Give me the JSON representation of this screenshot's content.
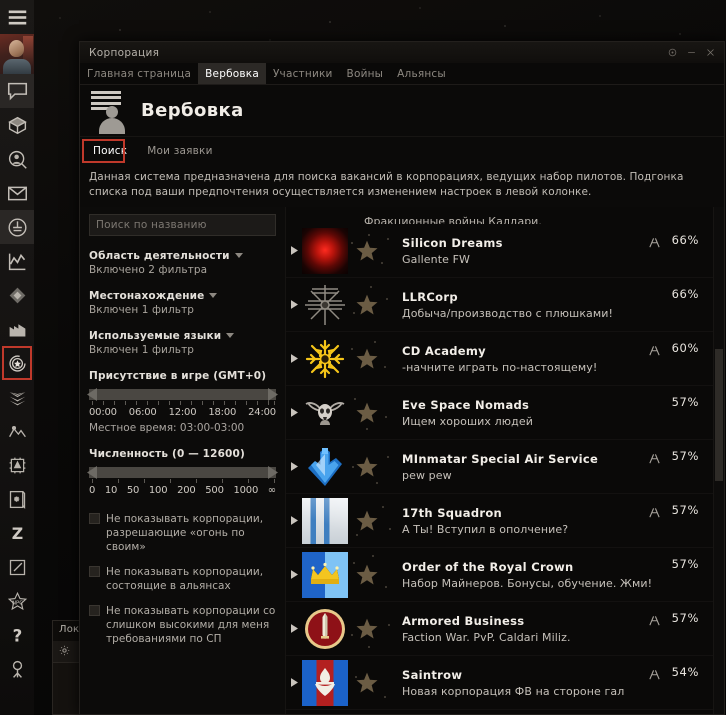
{
  "neocom": {
    "items": [
      {
        "name": "menu-icon",
        "label": "Меню"
      },
      {
        "name": "chat-icon",
        "label": "Чат"
      },
      {
        "name": "cargo-icon",
        "label": "Инвентарь"
      },
      {
        "name": "character-search-icon",
        "label": "Поиск персонажа"
      },
      {
        "name": "mail-icon",
        "label": "Почта"
      },
      {
        "name": "station-icon",
        "label": "Станция"
      },
      {
        "name": "market-chart-icon",
        "label": "Рынок"
      },
      {
        "name": "map-icon",
        "label": "Карта"
      },
      {
        "name": "industry-icon",
        "label": "Производство"
      },
      {
        "name": "corporation-icon",
        "label": "Корпорация"
      },
      {
        "name": "fleet-icon",
        "label": "Флот"
      },
      {
        "name": "agency-icon",
        "label": "Агентство"
      },
      {
        "name": "fitting-icon",
        "label": "Сборка"
      },
      {
        "name": "journal-icon",
        "label": "Журнал"
      },
      {
        "name": "zkill-icon",
        "label": "Z"
      },
      {
        "name": "notepad-icon",
        "label": "Заметки"
      },
      {
        "name": "npc-standings-icon",
        "label": "Репутация"
      },
      {
        "name": "help-icon",
        "label": "Помощь"
      },
      {
        "name": "clone-icon",
        "label": "Клон"
      }
    ],
    "selected": "corporation-icon"
  },
  "background_panel": {
    "title": "Лок",
    "gear_icon": "gear-icon"
  },
  "window": {
    "title": "Корпорация",
    "controls": {
      "settings": "settings-icon",
      "minimize": "minimize-icon",
      "close": "close-icon"
    },
    "tabs": [
      {
        "label": "Главная страница",
        "active": false
      },
      {
        "label": "Вербовка",
        "active": true
      },
      {
        "label": "Участники",
        "active": false
      },
      {
        "label": "Войны",
        "active": false
      },
      {
        "label": "Альянсы",
        "active": false
      }
    ],
    "header": {
      "icon": "recruitment-icon",
      "title": "Вербовка"
    },
    "subtabs": [
      {
        "label": "Поиск",
        "selected": true
      },
      {
        "label": "Мои заявки",
        "selected": false
      }
    ],
    "description": "Данная система предназначена для поиска вакансий в корпорациях, ведущих набор пилотов. Подгонка списка под ваши предпочтения осуществляется изменением настроек в левой колонке."
  },
  "filters": {
    "search": {
      "placeholder": "Поиск по названию",
      "value": ""
    },
    "groups": [
      {
        "title": "Область деятельности",
        "chevron": "chevron-down-icon",
        "status": "Включено 2 фильтра"
      },
      {
        "title": "Местонахождение",
        "chevron": "chevron-down-icon",
        "status": "Включен 1 фильтр"
      },
      {
        "title": "Используемые языки",
        "chevron": "chevron-down-icon",
        "status": "Включен 1 фильтр"
      }
    ],
    "presence_slider": {
      "title": "Присутствие в игре (GMT+0)",
      "ticks": [
        "00:00",
        "06:00",
        "12:00",
        "18:00",
        "24:00"
      ],
      "local_time_label": "Местное время: 03:00-03:00",
      "range": [
        0,
        24
      ]
    },
    "size_slider": {
      "title": "Численность (0 — 12600)",
      "ticks": [
        "0",
        "10",
        "50",
        "100",
        "200",
        "500",
        "1000",
        "∞"
      ],
      "range": [
        0,
        12600
      ]
    },
    "checkboxes": [
      {
        "label": "Не показывать корпорации, разрешающие «огонь по своим»",
        "checked": false
      },
      {
        "label": "Не показывать корпорации, состоящие в альянсах",
        "checked": false
      },
      {
        "label": "Не показывать корпорации со слишком высокими для меня требованиями по СП",
        "checked": false
      }
    ]
  },
  "corp_list": {
    "clipped_top_row": "Фракционные войны Калдари.",
    "rows": [
      {
        "name": "Silicon Dreams",
        "desc": "Gallente FW",
        "pct": "66%",
        "alliance": true,
        "logo": "red-glow"
      },
      {
        "name": "LLRCorp",
        "desc": "Добыча/производство с плюшками!",
        "pct": "66%",
        "alliance": false,
        "logo": "compass-star"
      },
      {
        "name": "CD Academy",
        "desc": "-начните играть по-настоящему!",
        "pct": "60%",
        "alliance": true,
        "logo": "gold-snowflake"
      },
      {
        "name": "Eve Space Nomads",
        "desc": "Ищем хороших людей",
        "pct": "57%",
        "alliance": false,
        "logo": "skull-wings"
      },
      {
        "name": "MInmatar Special Air Service",
        "desc": "pew pew",
        "pct": "57%",
        "alliance": true,
        "logo": "blue-anchor"
      },
      {
        "name": "17th Squadron",
        "desc": "А Ты! Вступил в ополчение?",
        "pct": "57%",
        "alliance": true,
        "logo": "blue-stripes"
      },
      {
        "name": "Order of the Royal Crown",
        "desc": "Набор Майнеров. Бонусы, обучение. Жми!",
        "pct": "57%",
        "alliance": false,
        "logo": "gold-crown"
      },
      {
        "name": "Armored Business",
        "desc": "Faction War.  PvP. Caldari Miliz.",
        "pct": "57%",
        "alliance": true,
        "logo": "red-sword"
      },
      {
        "name": "Saintrow",
        "desc": "Новая корпорация ФВ на стороне гал",
        "pct": "54%",
        "alliance": true,
        "logo": "fleur-de-lis"
      }
    ]
  },
  "colors": {
    "accent_red": "#c0392b",
    "window_bg": "#0b0a09",
    "tab_active_bg": "#2c2926",
    "text_primary": "#f0ece6",
    "text_secondary": "#b3aea7"
  }
}
